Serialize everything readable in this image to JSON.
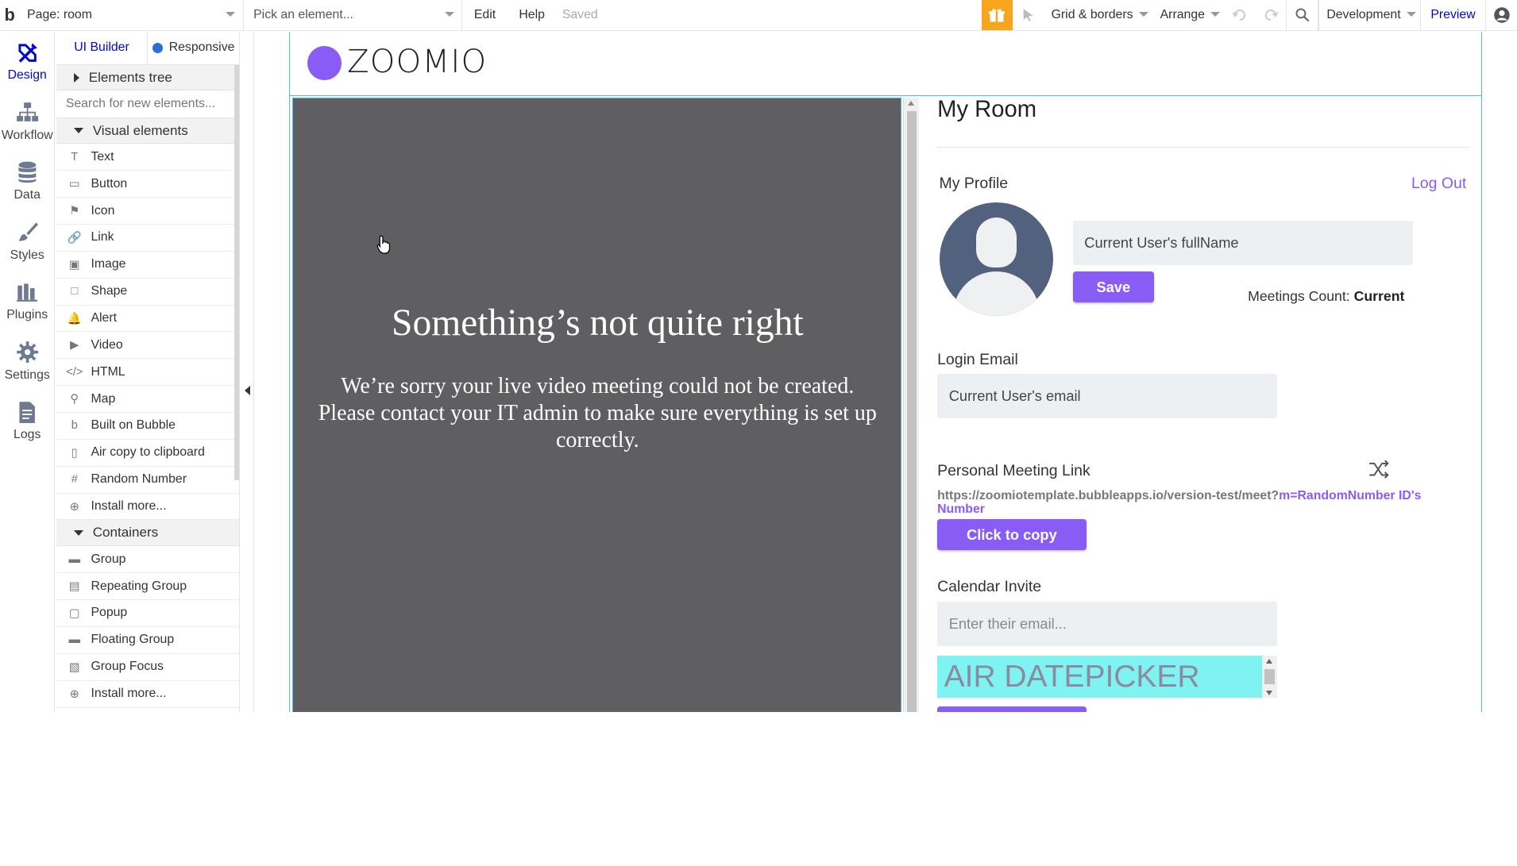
{
  "topbar": {
    "logo": "b",
    "page_label": "Page: room",
    "element_placeholder": "Pick an element...",
    "menu_edit": "Edit",
    "menu_help": "Help",
    "saved": "Saved",
    "grid_borders": "Grid & borders",
    "arrange": "Arrange",
    "environment": "Development",
    "preview": "Preview",
    "gift_color": "#f7a51c"
  },
  "leftnav": {
    "items": [
      {
        "label": "Design",
        "icon": "design-icon"
      },
      {
        "label": "Workflow",
        "icon": "workflow-icon"
      },
      {
        "label": "Data",
        "icon": "database-icon"
      },
      {
        "label": "Styles",
        "icon": "brush-icon"
      },
      {
        "label": "Plugins",
        "icon": "plugin-icon"
      },
      {
        "label": "Settings",
        "icon": "gear-icon"
      },
      {
        "label": "Logs",
        "icon": "document-icon"
      }
    ],
    "active_color": "#0205d3"
  },
  "palette": {
    "tab_ui_builder": "UI Builder",
    "tab_responsive": "Responsive",
    "elements_tree": "Elements tree",
    "search_placeholder": "Search for new elements...",
    "visual_elements": "Visual elements",
    "visual_items": [
      {
        "label": "Text",
        "icon": "T"
      },
      {
        "label": "Button",
        "icon": "▭"
      },
      {
        "label": "Icon",
        "icon": "⚑"
      },
      {
        "label": "Link",
        "icon": "🔗"
      },
      {
        "label": "Image",
        "icon": "▣"
      },
      {
        "label": "Shape",
        "icon": "□"
      },
      {
        "label": "Alert",
        "icon": "🔔"
      },
      {
        "label": "Video",
        "icon": "▶"
      },
      {
        "label": "HTML",
        "icon": "</>"
      },
      {
        "label": "Map",
        "icon": "⚲"
      },
      {
        "label": "Built on Bubble",
        "icon": "b"
      },
      {
        "label": "Air copy to clipboard",
        "icon": "▯"
      },
      {
        "label": "Random Number",
        "icon": "#"
      },
      {
        "label": "Install more...",
        "icon": "⊕"
      }
    ],
    "containers": "Containers",
    "container_items": [
      {
        "label": "Group",
        "icon": "▬"
      },
      {
        "label": "Repeating Group",
        "icon": "▤"
      },
      {
        "label": "Popup",
        "icon": "▢"
      },
      {
        "label": "Floating Group",
        "icon": "▬"
      },
      {
        "label": "Group Focus",
        "icon": "▧"
      },
      {
        "label": "Install more...",
        "icon": "⊕"
      }
    ]
  },
  "canvas": {
    "logo_text": "ZOOMIO",
    "logo_color": "#8a5cf6",
    "error_title": "Something’s not quite right",
    "error_body": "We’re sorry your live video meeting could not be created. Please contact your IT admin to make sure everything is set up correctly.",
    "room_title": "My Room",
    "profile_label": "My Profile",
    "logout": "Log Out",
    "fullname_value": "Current User's fullName",
    "save_button": "Save",
    "meetings_count_label": "Meetings Count:",
    "meetings_count_value": "Current",
    "login_email_label": "Login Email",
    "email_value": "Current User's email",
    "personal_link_label": "Personal Meeting Link",
    "link_static": "https://zoomiotemplate.bubbleapps.io/version-test/meet?",
    "link_dynamic": "m=RandomNumber ID's Number",
    "copy_button": "Click to copy",
    "calendar_label": "Calendar Invite",
    "invite_placeholder": "Enter their email...",
    "datepicker_text": "AIR DATEPICKER",
    "accent_color": "#8a5cf6"
  }
}
